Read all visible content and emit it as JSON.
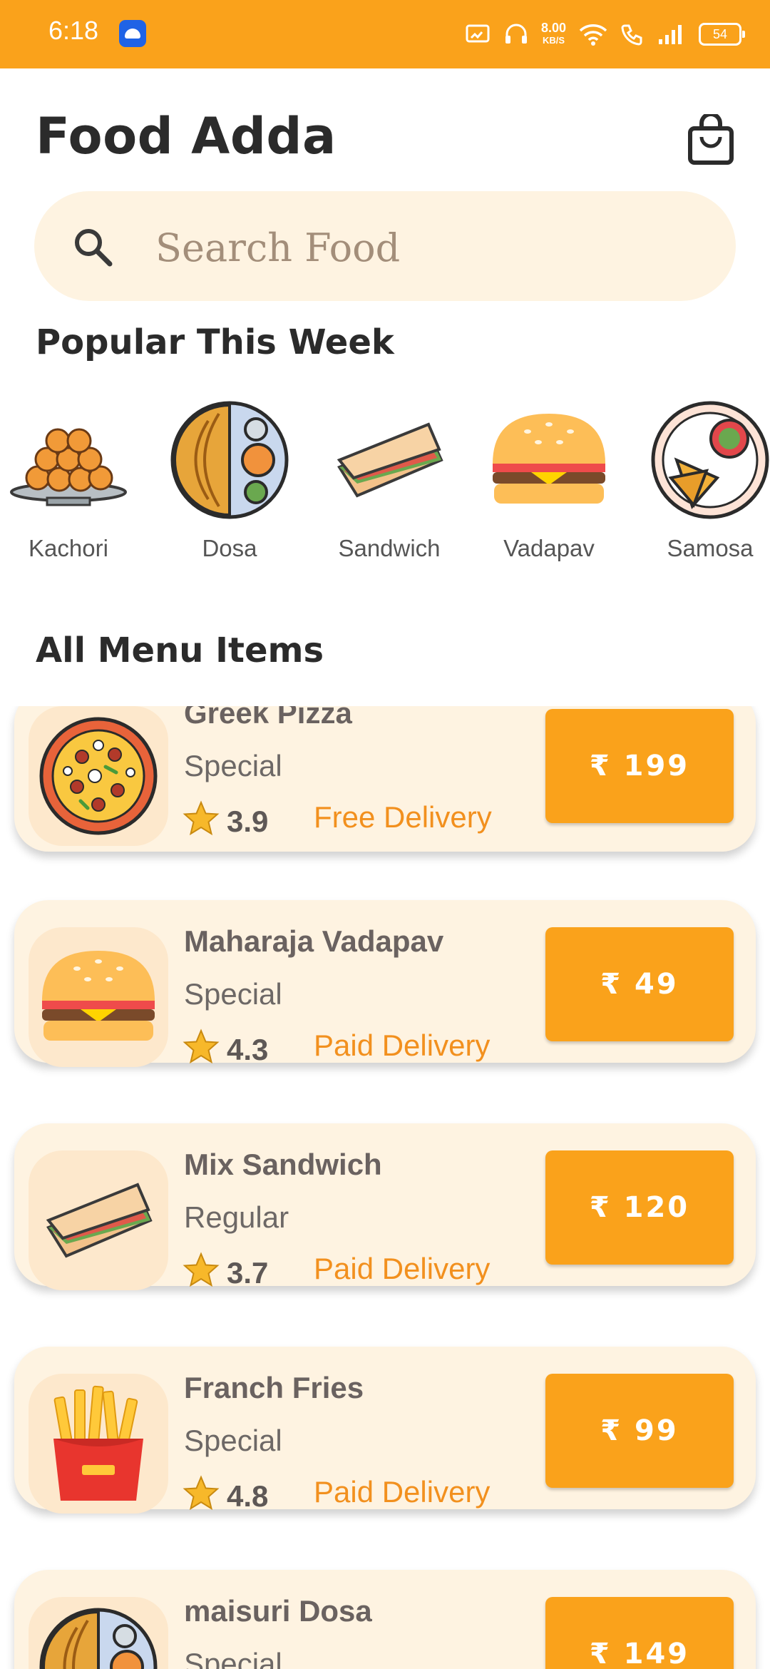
{
  "status_bar": {
    "time": "6:18",
    "net_speed": "8.00",
    "net_unit": "KB/S",
    "battery": "54"
  },
  "header": {
    "title": "Food Adda"
  },
  "search": {
    "placeholder": "Search Food"
  },
  "popular": {
    "title": "Popular This Week",
    "items": [
      {
        "label": "Kachori"
      },
      {
        "label": "Dosa"
      },
      {
        "label": "Sandwich"
      },
      {
        "label": "Vadapav"
      },
      {
        "label": "Samosa"
      }
    ]
  },
  "menu": {
    "title": "All Menu Items",
    "currency": "₹",
    "items": [
      {
        "name": "Greek Pizza",
        "category": "Special",
        "rating": "3.9",
        "delivery": "Free Delivery",
        "price": "₹ 199",
        "icon": "pizza-icon"
      },
      {
        "name": "Maharaja Vadapav",
        "category": "Special",
        "rating": "4.3",
        "delivery": "Paid Delivery",
        "price": "₹ 49",
        "icon": "burger-icon"
      },
      {
        "name": "Mix Sandwich",
        "category": "Regular",
        "rating": "3.7",
        "delivery": "Paid Delivery",
        "price": "₹ 120",
        "icon": "sandwich-icon"
      },
      {
        "name": "Franch Fries",
        "category": "Special",
        "rating": "4.8",
        "delivery": "Paid Delivery",
        "price": "₹ 99",
        "icon": "fries-icon"
      },
      {
        "name": "maisuri Dosa",
        "category": "Special",
        "rating": "",
        "delivery": "",
        "price": "₹ 149",
        "icon": "dosa-icon"
      }
    ]
  },
  "colors": {
    "accent": "#FAA21B",
    "card_bg": "#FEF3E1",
    "delivery_text": "#F2901E"
  }
}
